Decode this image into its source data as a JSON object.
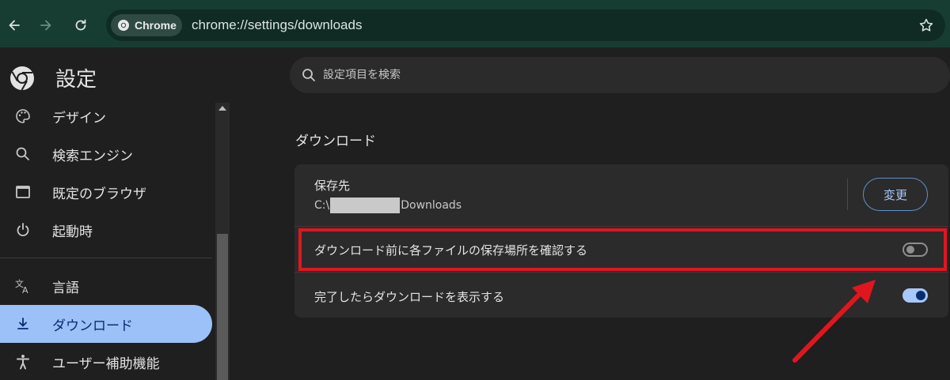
{
  "browser": {
    "chip_label": "Chrome",
    "url": "chrome://settings/downloads",
    "icons": [
      "back-icon",
      "forward-icon",
      "reload-icon",
      "chrome-logo-icon",
      "bookmark-star-icon"
    ]
  },
  "sidebar": {
    "title": "設定",
    "items": [
      {
        "label": "デザイン",
        "icon": "palette-icon"
      },
      {
        "label": "検索エンジン",
        "icon": "search-icon"
      },
      {
        "label": "既定のブラウザ",
        "icon": "browser-window-icon"
      },
      {
        "label": "起動時",
        "icon": "power-icon"
      },
      {
        "label": "言語",
        "icon": "translate-icon"
      },
      {
        "label": "ダウンロード",
        "icon": "download-icon",
        "active": true
      },
      {
        "label": "ユーザー補助機能",
        "icon": "accessibility-icon"
      }
    ]
  },
  "search": {
    "placeholder": "設定項目を検索"
  },
  "main": {
    "section_title": "ダウンロード",
    "location": {
      "label": "保存先",
      "path_prefix": "C:\\",
      "path_suffix": "Downloads",
      "change_button": "変更"
    },
    "ask_where_to_save": {
      "label": "ダウンロード前に各ファイルの保存場所を確認する",
      "enabled": false
    },
    "show_downloads_when_done": {
      "label": "完了したらダウンロードを表示する",
      "enabled": true
    }
  },
  "colors": {
    "active_nav": "#9cc0f8",
    "toggle_on": "#a8c7fa",
    "annotation": "#e0161f",
    "toolbar": "#173d33"
  }
}
